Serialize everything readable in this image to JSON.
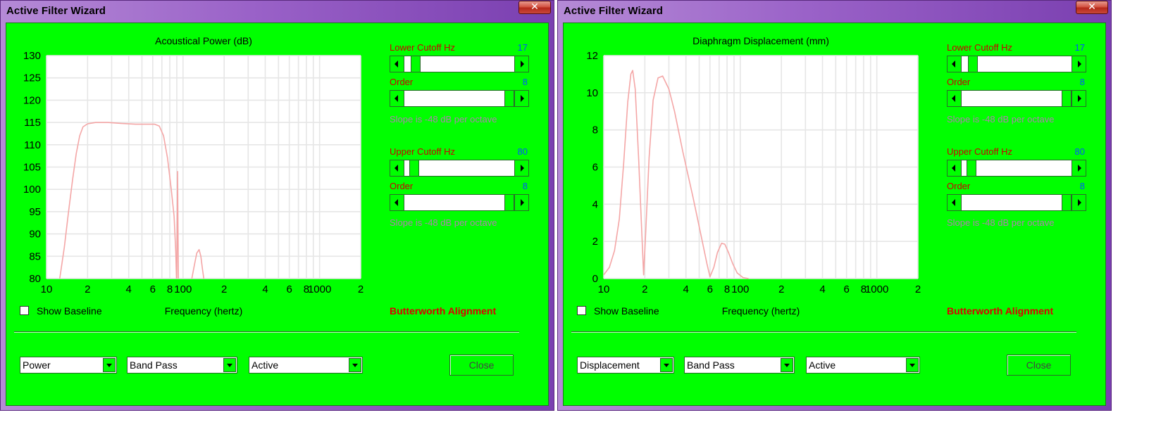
{
  "windows": [
    {
      "title": "Active Filter Wizard",
      "close_glyph": "✕",
      "plot_title": "Acoustical Power (dB)",
      "lower_cutoff_label": "Lower Cutoff  Hz",
      "lower_cutoff_value": "17",
      "lower_cutoff_fraction": 0.06,
      "lower_order_label": "Order",
      "lower_order_value": "8",
      "lower_order_fraction": 1.0,
      "lower_slope_text": "Slope is -48 dB per octave",
      "upper_cutoff_label": "Upper Cutoff  Hz",
      "upper_cutoff_value": "80",
      "upper_cutoff_fraction": 0.05,
      "upper_order_label": "Order",
      "upper_order_value": "8",
      "upper_order_fraction": 1.0,
      "upper_slope_text": "Slope is -48 dB per octave",
      "show_baseline_label": "Show Baseline",
      "show_baseline_checked": false,
      "x_axis_label": "Frequency (hertz)",
      "alignment_text": "Butterworth Alignment",
      "combo1": "Power",
      "combo2": "Band Pass",
      "combo3": "Active",
      "close_button": "Close",
      "chart_data": {
        "type": "line",
        "title": "Acoustical Power (dB)",
        "xlabel": "Frequency (hertz)",
        "ylabel": "",
        "xscale": "log",
        "xlim": [
          10,
          2000
        ],
        "ylim": [
          80,
          130
        ],
        "x_tick_labels": [
          "10",
          "2",
          "4",
          "6",
          "8",
          "100",
          "2",
          "4",
          "6",
          "8",
          "1000",
          "2"
        ],
        "y_tick_labels": [
          "130",
          "125",
          "120",
          "115",
          "110",
          "105",
          "100",
          "95",
          "90",
          "85",
          "80"
        ],
        "grid": true,
        "series_color": "#f4a6a6",
        "segments": [
          [
            [
              12.5,
              80
            ],
            [
              13.5,
              87
            ],
            [
              14.5,
              95
            ],
            [
              15.5,
              102
            ],
            [
              16.5,
              108
            ],
            [
              17.5,
              112
            ],
            [
              18.5,
              114
            ],
            [
              20,
              114.7
            ],
            [
              23,
              115
            ],
            [
              28,
              115
            ],
            [
              35,
              114.8
            ],
            [
              45,
              114.6
            ],
            [
              55,
              114.6
            ],
            [
              62,
              114.6
            ],
            [
              67,
              114.2
            ],
            [
              72,
              112
            ],
            [
              77,
              107
            ],
            [
              82,
              100
            ],
            [
              86,
              94
            ],
            [
              88.5,
              86
            ],
            [
              89.5,
              80
            ]
          ],
          [
            [
              90,
              80
            ],
            [
              90.6,
              92
            ],
            [
              91.2,
              104
            ],
            [
              91.8,
              92
            ],
            [
              92.5,
              80
            ]
          ],
          [
            [
              116,
              80
            ],
            [
              121,
              83
            ],
            [
              126,
              85.7
            ],
            [
              131,
              86.5
            ],
            [
              135,
              85
            ],
            [
              139,
              82
            ],
            [
              142,
              80
            ]
          ]
        ]
      }
    },
    {
      "title": "Active Filter Wizard",
      "close_glyph": "✕",
      "plot_title": "Diaphragm Displacement (mm)",
      "lower_cutoff_label": "Lower Cutoff  Hz",
      "lower_cutoff_value": "17",
      "lower_cutoff_fraction": 0.06,
      "lower_order_label": "Order",
      "lower_order_value": "8",
      "lower_order_fraction": 1.0,
      "lower_slope_text": "Slope is -48 dB per octave",
      "upper_cutoff_label": "Upper Cutoff  Hz",
      "upper_cutoff_value": "80",
      "upper_cutoff_fraction": 0.05,
      "upper_order_label": "Order",
      "upper_order_value": "8",
      "upper_order_fraction": 1.0,
      "upper_slope_text": "Slope is -48 dB per octave",
      "show_baseline_label": "Show Baseline",
      "show_baseline_checked": false,
      "x_axis_label": "Frequency (hertz)",
      "alignment_text": "Butterworth Alignment",
      "combo1": "Displacement",
      "combo2": "Band Pass",
      "combo3": "Active",
      "close_button": "Close",
      "chart_data": {
        "type": "line",
        "title": "Diaphragm Displacement (mm)",
        "xlabel": "Frequency (hertz)",
        "ylabel": "",
        "xscale": "log",
        "xlim": [
          10,
          2000
        ],
        "ylim": [
          0,
          12
        ],
        "x_tick_labels": [
          "10",
          "2",
          "4",
          "6",
          "8",
          "100",
          "2",
          "4",
          "6",
          "8",
          "1000",
          "2"
        ],
        "y_tick_labels": [
          "12",
          "10",
          "8",
          "6",
          "4",
          "2",
          "0"
        ],
        "grid": true,
        "series_color": "#f4a6a6",
        "segments": [
          [
            [
              10,
              0.2
            ],
            [
              11,
              0.6
            ],
            [
              12,
              1.5
            ],
            [
              13,
              3.2
            ],
            [
              14,
              6.2
            ],
            [
              15,
              9.5
            ],
            [
              15.8,
              11.0
            ],
            [
              16.3,
              11.2
            ],
            [
              17,
              10.2
            ],
            [
              18,
              6.5
            ],
            [
              19,
              2.5
            ],
            [
              19.6,
              0.2
            ],
            [
              20.3,
              2.5
            ],
            [
              21.5,
              6.5
            ],
            [
              23,
              9.6
            ],
            [
              25,
              10.8
            ],
            [
              27,
              10.9
            ],
            [
              30,
              10.2
            ],
            [
              33,
              9
            ],
            [
              38,
              6.8
            ],
            [
              45,
              4.4
            ],
            [
              52,
              2.2
            ],
            [
              57,
              0.8
            ],
            [
              60,
              0.1
            ],
            [
              64,
              0.6
            ],
            [
              68,
              1.4
            ],
            [
              73,
              1.9
            ],
            [
              77,
              1.85
            ],
            [
              82,
              1.4
            ],
            [
              88,
              0.8
            ],
            [
              95,
              0.3
            ],
            [
              105,
              0.05
            ],
            [
              115,
              0
            ]
          ]
        ]
      }
    }
  ]
}
